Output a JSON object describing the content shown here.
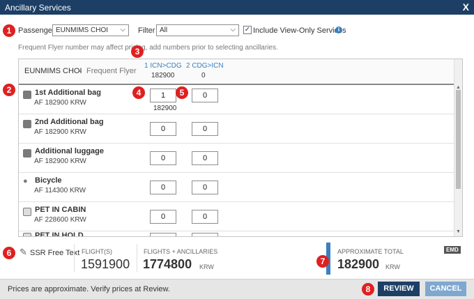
{
  "window": {
    "title": "Ancillary Services",
    "close_glyph": "X"
  },
  "badges": [
    "1",
    "2",
    "3",
    "4",
    "5",
    "6",
    "7",
    "8"
  ],
  "passenger": {
    "label": "Passenger",
    "selected": "EUNMIMS CHOI"
  },
  "filter": {
    "label": "Filter",
    "selected": "All"
  },
  "view_only": {
    "label": "Include View-Only Services",
    "checked": true
  },
  "note": "Frequent Flyer number may affect pricing, add numbers prior to selecting ancillaries.",
  "header": {
    "name": "EUNMIMS CHOI",
    "separator": "-",
    "ff_label": "Frequent Flyer",
    "segments": [
      {
        "route": "1 ICN>CDG",
        "total": "182900"
      },
      {
        "route": "2 CDG>ICN",
        "total": "0"
      }
    ]
  },
  "items": [
    {
      "name": "1st Additional bag",
      "price": "AF  182900 KRW",
      "icon": "bag-icon",
      "qty": [
        "1",
        "0"
      ],
      "subtotal": "182900"
    },
    {
      "name": "2nd Additional bag",
      "price": "AF  182900 KRW",
      "icon": "bag-icon",
      "qty": [
        "0",
        "0"
      ],
      "subtotal": ""
    },
    {
      "name": "Additional luggage",
      "price": "AF  182900 KRW",
      "icon": "bag-icon",
      "qty": [
        "0",
        "0"
      ],
      "subtotal": ""
    },
    {
      "name": "Bicycle",
      "price": "AF  114300 KRW",
      "icon": "bicycle-icon",
      "qty": [
        "0",
        "0"
      ],
      "subtotal": ""
    },
    {
      "name": "PET IN CABIN",
      "price": "AF  228600 KRW",
      "icon": "pet-icon",
      "qty": [
        "0",
        "0"
      ],
      "subtotal": ""
    },
    {
      "name": "PET IN HOLD",
      "price": "",
      "icon": "pet-icon",
      "qty": [
        "",
        ""
      ],
      "subtotal": ""
    }
  ],
  "ssr": {
    "label": "SSR Free Text"
  },
  "totals": {
    "flights_label": "FLIGHT(S)",
    "flights_value": "1591900",
    "fa_label": "FLIGHTS + ANCILLARIES",
    "fa_value": "1774800",
    "fa_unit": "KRW",
    "approx_label": "APPROXIMATE TOTAL",
    "emd_badge": "EMD",
    "approx_value": "182900",
    "approx_unit": "KRW"
  },
  "footer": {
    "note": "Prices are approximate. Verify prices at Review.",
    "review": "REVIEW",
    "cancel": "CANCEL"
  },
  "colors": {
    "titlebar": "#1d3f66",
    "badge": "#e02020",
    "link": "#3a7fc1",
    "review": "#1d3f66",
    "cancel": "#7fa8cf",
    "accent": "#3a7fc1"
  }
}
